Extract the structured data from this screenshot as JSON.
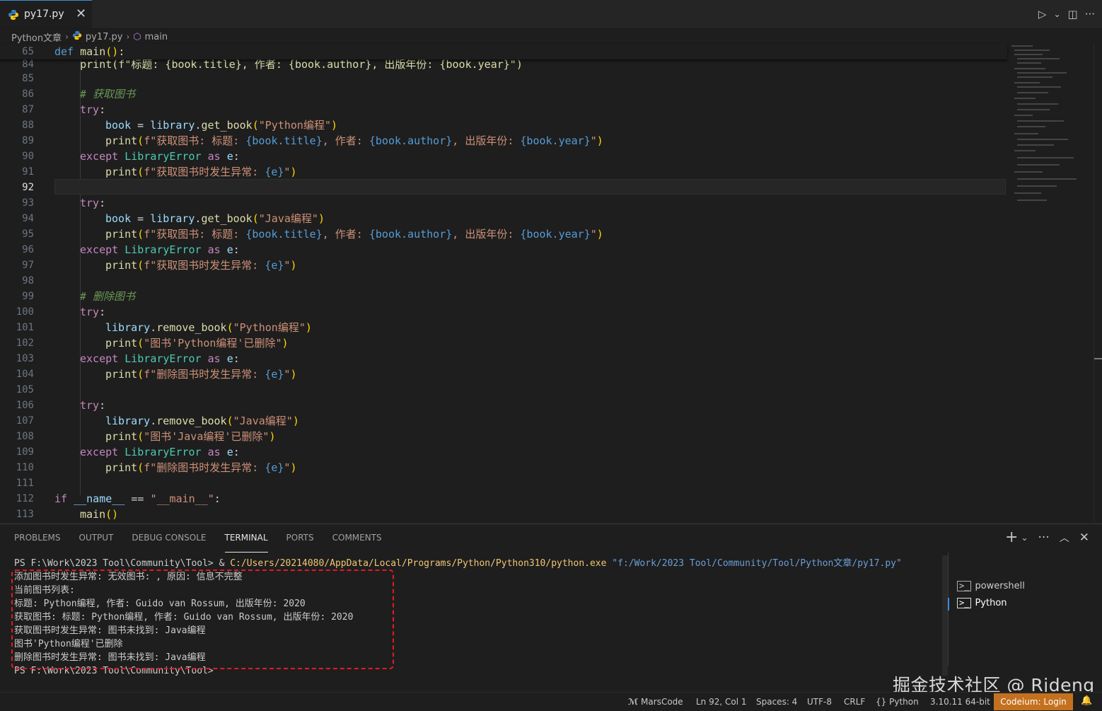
{
  "tab": {
    "label": "py17.py",
    "close": "✕"
  },
  "top_actions": {
    "run": "▷",
    "run_menu": "⌄",
    "split": "◫",
    "more": "···"
  },
  "breadcrumb": {
    "folder": "Python文章",
    "file": "py17.py",
    "symbol": "main"
  },
  "sticky": {
    "num": "65",
    "code": "def main():"
  },
  "overlap_line": {
    "num": "84",
    "code": "    print(f\"标题: {book.title}, 作者: {book.author}, 出版年份: {book.year}\")"
  },
  "lines": [
    {
      "num": "85"
    },
    {
      "num": "86"
    },
    {
      "num": "87"
    },
    {
      "num": "88"
    },
    {
      "num": "89"
    },
    {
      "num": "90"
    },
    {
      "num": "91"
    },
    {
      "num": "92"
    },
    {
      "num": "93"
    },
    {
      "num": "94"
    },
    {
      "num": "95"
    },
    {
      "num": "96"
    },
    {
      "num": "97"
    },
    {
      "num": "98"
    },
    {
      "num": "99"
    },
    {
      "num": "100"
    },
    {
      "num": "101"
    },
    {
      "num": "102"
    },
    {
      "num": "103"
    },
    {
      "num": "104"
    },
    {
      "num": "105"
    },
    {
      "num": "106"
    },
    {
      "num": "107"
    },
    {
      "num": "108"
    },
    {
      "num": "109"
    },
    {
      "num": "110"
    },
    {
      "num": "111"
    },
    {
      "num": "112"
    },
    {
      "num": "113"
    }
  ],
  "code": {
    "c86": "# 获取图书",
    "try": "try",
    "colon": ":",
    "book": "book",
    "eq": " = ",
    "library": "library",
    "dot": ".",
    "get_book": "get_book",
    "paren_o": "(",
    "paren_c": ")",
    "s88": "\"Python编程\"",
    "print": "print",
    "f89": "f\"获取图书: 标题: ",
    "b_title": "{book.title}",
    "s_author": ", 作者: ",
    "b_author": "{book.author}",
    "s_year": ", 出版年份: ",
    "b_year": "{book.year}",
    "q": "\"",
    "except": "except",
    "LibraryError": "LibraryError",
    "as": "as",
    "e": "e",
    "f91": "f\"获取图书时发生异常: ",
    "be": "{e}",
    "s94": "\"Java编程\"",
    "c99": "# 删除图书",
    "remove_book": "remove_book",
    "s102": "\"图书'Python编程'已删除\"",
    "f104": "f\"删除图书时发生异常: ",
    "s108": "\"图书'Java编程'已删除\"",
    "if": "if",
    "name": "__name__",
    "eqeq": " == ",
    "s112": "\"__main__\"",
    "main": "main",
    "unit": "()"
  },
  "panel": {
    "tabs": [
      "PROBLEMS",
      "OUTPUT",
      "DEBUG CONSOLE",
      "TERMINAL",
      "PORTS",
      "COMMENTS"
    ],
    "active_tab": "TERMINAL",
    "actions": {
      "add": "+",
      "add_menu": "⌄",
      "more": "···",
      "maximize": "︿",
      "close": "✕"
    },
    "terminal": {
      "prompt": "PS F:\\Work\\2023 Tool\\Community\\Tool> & ",
      "exe": "C:/Users/20214080/AppData/Local/Programs/Python/Python310/python.exe",
      "script": "\"f:/Work/2023 Tool/Community/Tool/Python文章/py17.py\"",
      "output": [
        "添加图书时发生异常: 无效图书: , 原因: 信息不完整",
        "当前图书列表:",
        "标题: Python编程, 作者: Guido van Rossum, 出版年份: 2020",
        "获取图书: 标题: Python编程, 作者: Guido van Rossum, 出版年份: 2020",
        "获取图书时发生异常: 图书未找到: Java编程",
        "图书'Python编程'已删除",
        "删除图书时发生异常: 图书未找到: Java编程"
      ],
      "final_prompt": "PS F:\\Work\\2023 Tool\\Community\\Tool>"
    },
    "terminal_list": [
      "powershell",
      "Python"
    ],
    "watermark": "掘金技术社区 @ Rjdeng"
  },
  "status": {
    "marscode": "MarsCode",
    "position": "Ln 92, Col 1",
    "spaces": "Spaces: 4",
    "encoding": "UTF-8",
    "eol": "CRLF",
    "language": "Python",
    "interpreter": "3.10.11 64-bit",
    "codeium": "Codeium: Login",
    "bell": "🔔"
  },
  "colors": {
    "keyword": "#c586c0",
    "function": "#dcdcaa",
    "string": "#ce9178",
    "variable": "#9cdcfe",
    "class": "#4ec9b0",
    "comment": "#6a9955",
    "codeium_bg": "#c4711f",
    "accent": "#3c8fd8"
  }
}
